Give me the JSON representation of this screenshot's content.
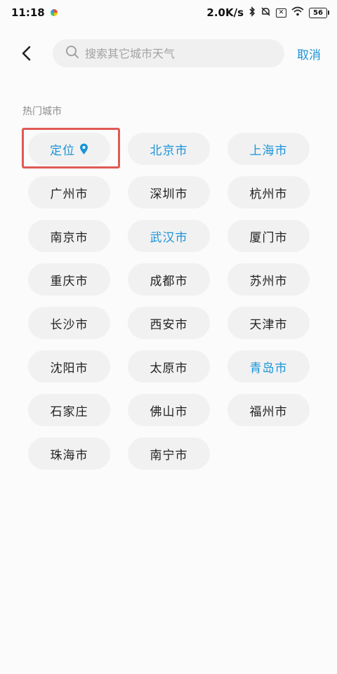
{
  "status_bar": {
    "time": "11:18",
    "speed": "2.0K/s",
    "battery": "56"
  },
  "header": {
    "search_placeholder": "搜索其它城市天气",
    "cancel_label": "取消"
  },
  "section": {
    "title": "热门城市"
  },
  "cities": [
    {
      "label": "定位",
      "color": "blue",
      "icon": "location-pin-icon"
    },
    {
      "label": "北京市",
      "color": "blue"
    },
    {
      "label": "上海市",
      "color": "blue"
    },
    {
      "label": "广州市",
      "color": "default"
    },
    {
      "label": "深圳市",
      "color": "default"
    },
    {
      "label": "杭州市",
      "color": "default"
    },
    {
      "label": "南京市",
      "color": "default"
    },
    {
      "label": "武汉市",
      "color": "blue"
    },
    {
      "label": "厦门市",
      "color": "default"
    },
    {
      "label": "重庆市",
      "color": "default"
    },
    {
      "label": "成都市",
      "color": "default"
    },
    {
      "label": "苏州市",
      "color": "default"
    },
    {
      "label": "长沙市",
      "color": "default"
    },
    {
      "label": "西安市",
      "color": "default"
    },
    {
      "label": "天津市",
      "color": "default"
    },
    {
      "label": "沈阳市",
      "color": "default"
    },
    {
      "label": "太原市",
      "color": "default"
    },
    {
      "label": "青岛市",
      "color": "blue"
    },
    {
      "label": "石家庄",
      "color": "default"
    },
    {
      "label": "佛山市",
      "color": "default"
    },
    {
      "label": "福州市",
      "color": "default"
    },
    {
      "label": "珠海市",
      "color": "default"
    },
    {
      "label": "南宁市",
      "color": "default"
    }
  ],
  "colors": {
    "accent": "#1a94d9",
    "highlight": "#e05a55",
    "chip_bg": "#f1f1f1"
  }
}
